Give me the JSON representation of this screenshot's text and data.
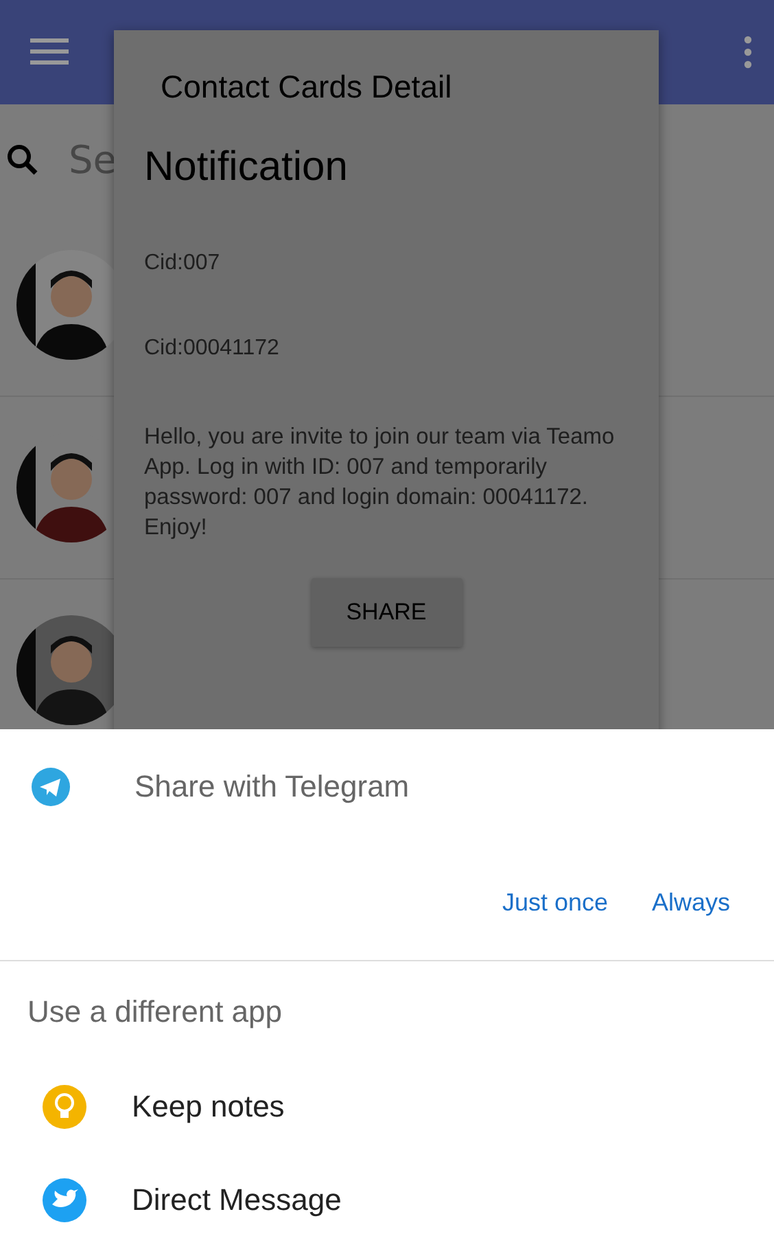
{
  "search": {
    "placeholder": "Se"
  },
  "dialog": {
    "title": "Contact Cards Detail",
    "heading": "Notification",
    "lines": [
      "Cid:007",
      "Cid:00041172"
    ],
    "message": "Hello, you are invite to join our team via Teamo App. Log in with ID: 007 and temporarily password: 007 and login domain: 00041172. Enjoy!",
    "button": "SHARE"
  },
  "share_sheet": {
    "preferred": {
      "label": "Share with Telegram"
    },
    "actions": [
      "Just once",
      "Always"
    ],
    "section_title": "Use a different app",
    "apps": [
      {
        "label": "Keep notes"
      },
      {
        "label": "Direct Message"
      }
    ]
  }
}
